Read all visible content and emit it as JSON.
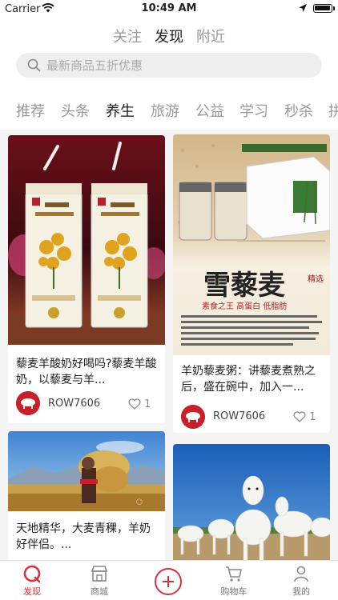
{
  "status": {
    "carrier": "Carrier",
    "time": "10:49 AM"
  },
  "top_tabs": [
    {
      "label": "关注"
    },
    {
      "label": "发现"
    },
    {
      "label": "附近"
    }
  ],
  "search": {
    "placeholder": "最新商品五折优惠"
  },
  "categories": [
    {
      "label": "推荐"
    },
    {
      "label": "头条"
    },
    {
      "label": "养生"
    },
    {
      "label": "旅游"
    },
    {
      "label": "公益"
    },
    {
      "label": "学习"
    },
    {
      "label": "秒杀"
    },
    {
      "label": "拼"
    }
  ],
  "feed": [
    {
      "title": "藜麦羊酸奶好喝吗?藜麦羊酸奶，以藜麦与羊...",
      "author": "ROW7606",
      "likes": "1",
      "image": "quinoa-goat-yogurt-cartons"
    },
    {
      "title": "羊奶藜麦粥：讲藜麦煮熟之后，盛在碗中，加入一...",
      "author": "ROW7606",
      "likes": "1",
      "image": "snow-quinoa-product-poster",
      "poster_text": {
        "title": "雪藜麦",
        "seal": "精选",
        "slogan": "素食之王 高蛋白 低脂肪"
      }
    },
    {
      "title": "天地精华，大麦青稞，羊奶好伴侣。...",
      "image": "tibetan-woman-barley-harvest"
    },
    {
      "image": "white-goats-field"
    }
  ],
  "tabbar": [
    {
      "label": "发现",
      "icon": "discover-icon"
    },
    {
      "label": "商城",
      "icon": "store-icon"
    },
    {
      "label": "",
      "icon": "add-icon"
    },
    {
      "label": "购物车",
      "icon": "cart-icon"
    },
    {
      "label": "我的",
      "icon": "profile-icon"
    }
  ],
  "colors": {
    "accent": "#d8303a",
    "background": "#f4f4f4"
  }
}
